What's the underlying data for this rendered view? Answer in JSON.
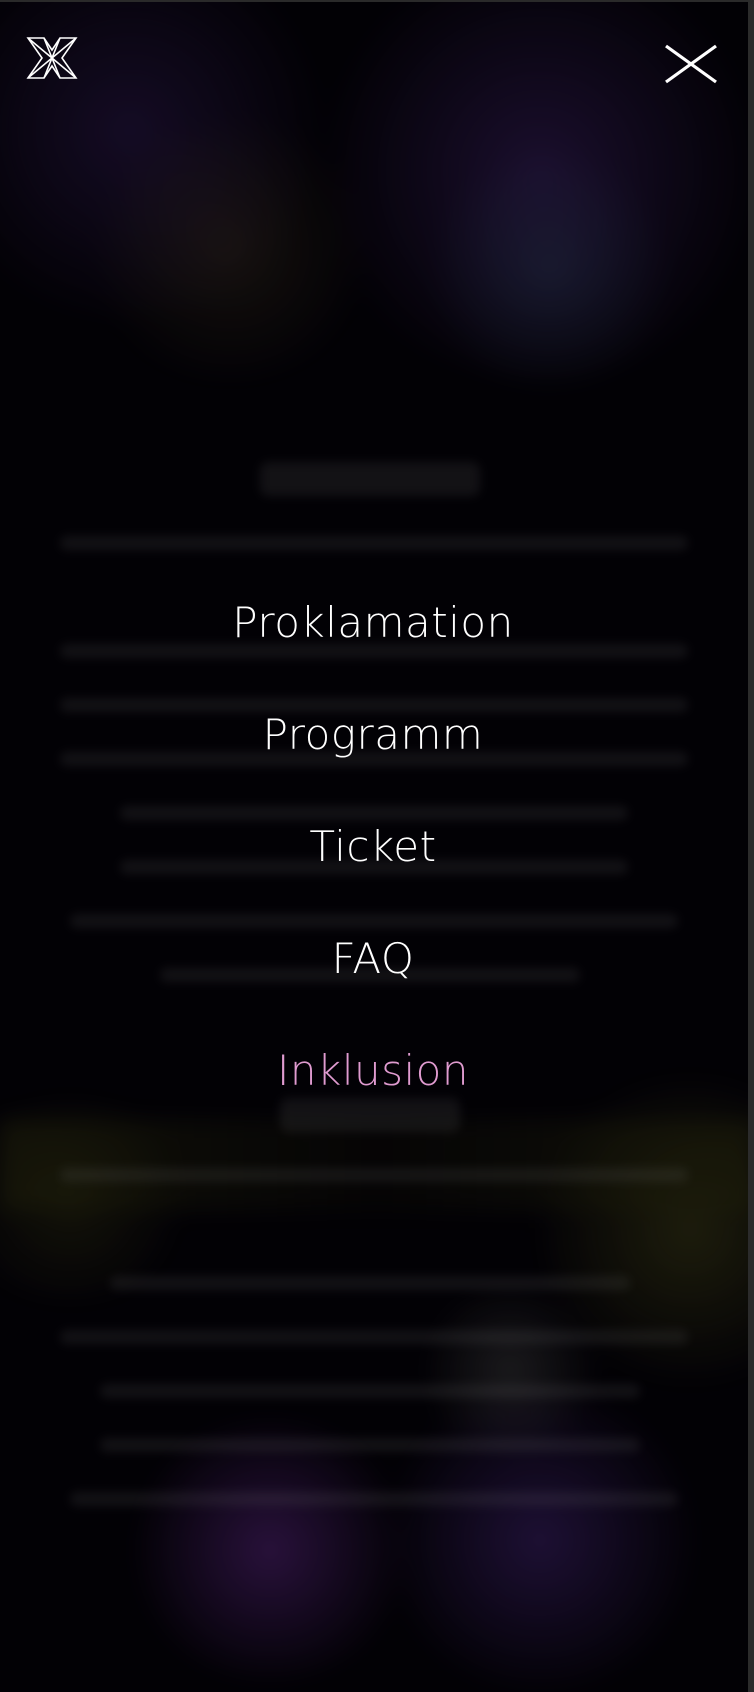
{
  "header": {
    "logo_icon": "festival-x-logo-icon",
    "close_icon": "close-icon"
  },
  "menu": {
    "items": [
      {
        "label": "Proklamation",
        "active": false
      },
      {
        "label": "Programm",
        "active": false
      },
      {
        "label": "Ticket",
        "active": false
      },
      {
        "label": "FAQ",
        "active": false
      },
      {
        "label": "Inklusion",
        "active": true
      }
    ]
  },
  "colors": {
    "overlay_background": "#000000",
    "menu_text": "#ffffff",
    "active_menu_text": "#e09bd0",
    "icon_stroke": "#ffffff"
  }
}
